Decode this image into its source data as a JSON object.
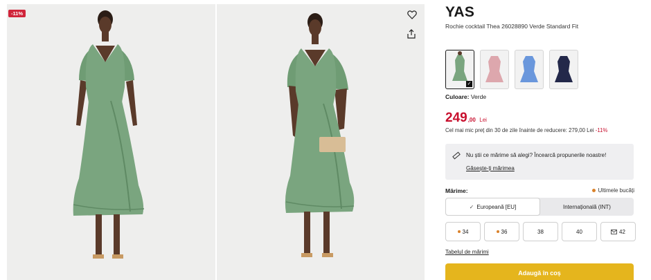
{
  "gallery": {
    "badge": "-11%",
    "icons": {
      "wishlist": "heart-icon",
      "share": "share-icon"
    },
    "dress_color": "#7aa57f",
    "bg_color": "#eeeeed"
  },
  "product": {
    "brand": "YAS",
    "subtitle": "Rochie cocktail Thea 26028890 Verde Standard Fit"
  },
  "colors": {
    "swatches": [
      {
        "name": "Verde",
        "hex": "#7aa57f",
        "selected": true
      },
      {
        "name": "Roz",
        "hex": "#dda7ad",
        "selected": false
      },
      {
        "name": "Albastru",
        "hex": "#6a97dc",
        "selected": false
      },
      {
        "name": "Bleumarin",
        "hex": "#23284a",
        "selected": false
      }
    ],
    "label": "Culoare:",
    "value": "Verde"
  },
  "price": {
    "int": "249",
    "dec": ",00",
    "currency": "Lei",
    "accent": "#c8102e",
    "lowest_text": "Cel mai mic preț din 30 de zile înainte de reducere: 279,00 Lei",
    "lowest_pct": "-11%"
  },
  "size_help": {
    "question": "Nu știi ce mărime să alegi? Încearcă propunerile noastre!",
    "link": "Găsește-ți mărimea"
  },
  "sizes": {
    "label": "Mărime:",
    "last_items": "Ultimele bucăți",
    "toggle": {
      "eu": "Europeană [EU]",
      "int": "Internațională (INT)"
    },
    "options": [
      {
        "label": "34",
        "marker": "dot"
      },
      {
        "label": "36",
        "marker": "dot"
      },
      {
        "label": "38",
        "marker": ""
      },
      {
        "label": "40",
        "marker": ""
      },
      {
        "label": "42",
        "marker": "mail"
      }
    ],
    "table_link": "Tabelul de mărimi"
  },
  "cta": {
    "label": "Adaugă în coș",
    "color": "#e5b51d"
  }
}
